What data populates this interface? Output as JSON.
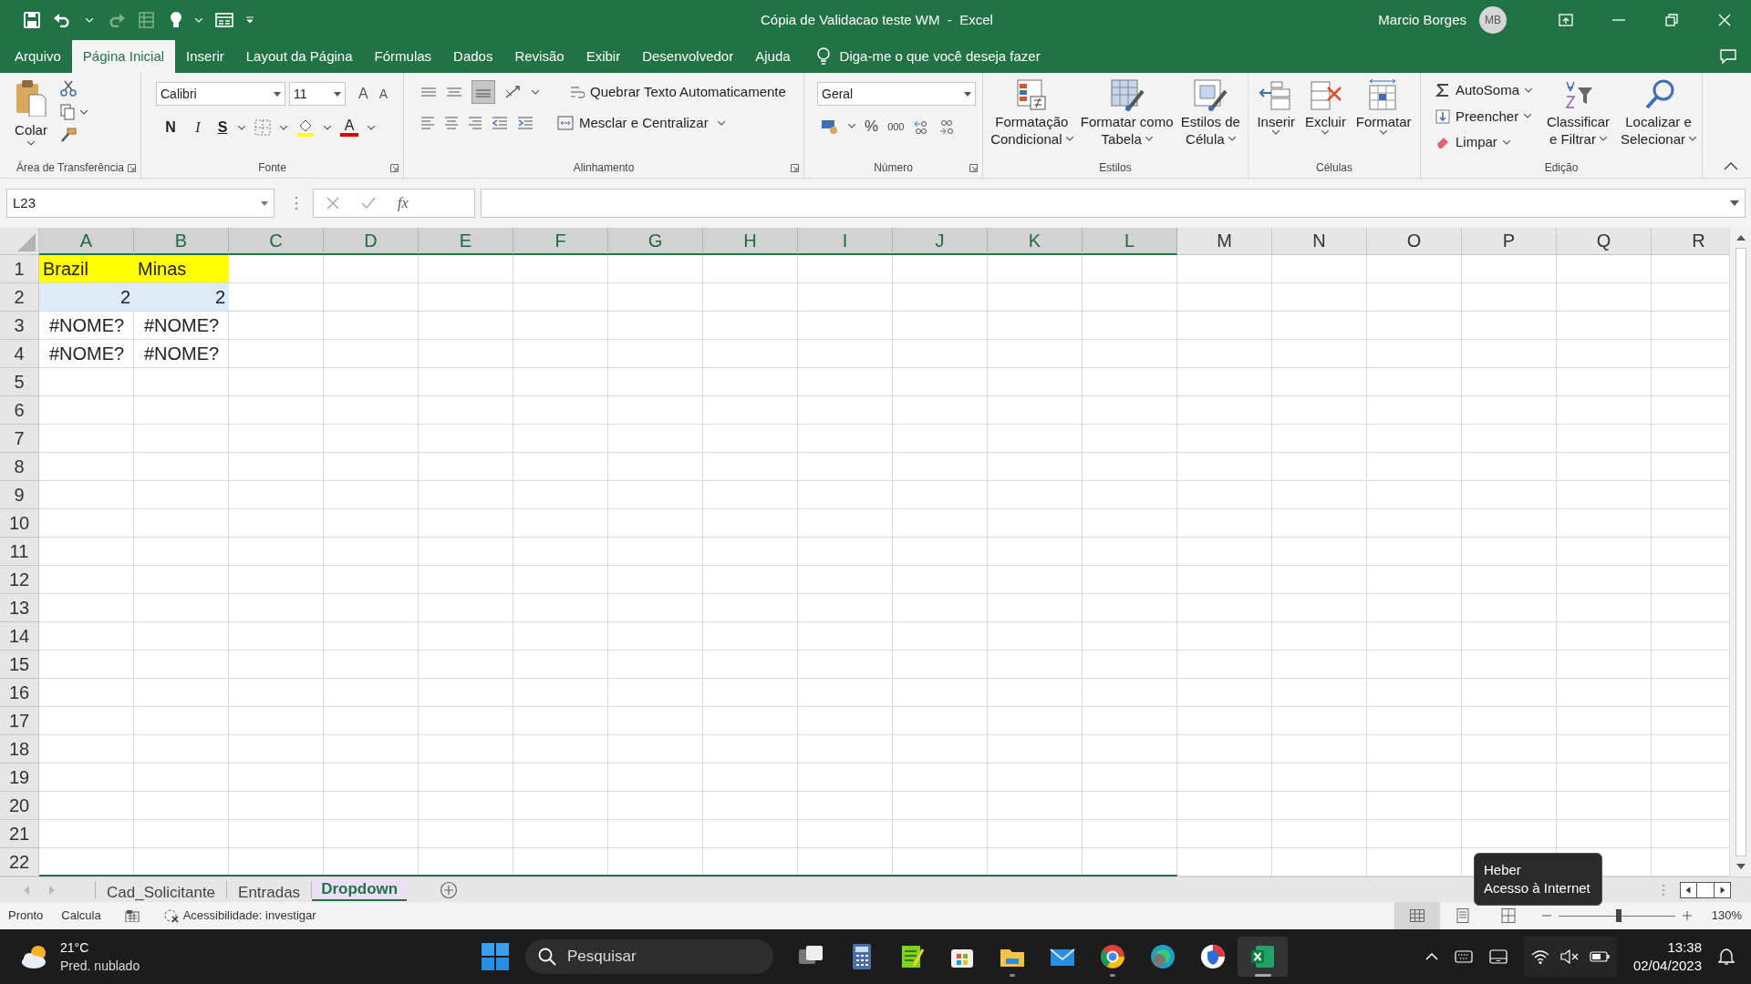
{
  "window": {
    "title": "Cópia de Validacao teste WM  -  Excel",
    "user": "Marcio Borges",
    "user_initials": "MB"
  },
  "ribbon_tabs": [
    {
      "label": "Arquivo",
      "selected": false
    },
    {
      "label": "Página Inicial",
      "selected": true
    },
    {
      "label": "Inserir",
      "selected": false
    },
    {
      "label": "Layout da Página",
      "selected": false
    },
    {
      "label": "Fórmulas",
      "selected": false
    },
    {
      "label": "Dados",
      "selected": false
    },
    {
      "label": "Revisão",
      "selected": false
    },
    {
      "label": "Exibir",
      "selected": false
    },
    {
      "label": "Desenvolvedor",
      "selected": false
    },
    {
      "label": "Ajuda",
      "selected": false
    }
  ],
  "tell_me": {
    "placeholder": "Diga-me o que você deseja fazer"
  },
  "ribbon": {
    "clipboard": {
      "paste": "Colar",
      "label": "Área de Transferência"
    },
    "font": {
      "name": "Calibri",
      "size": "11",
      "grow": "A",
      "shrink": "A",
      "bold": "N",
      "italic": "I",
      "underline": "S",
      "font_color": "A",
      "label": "Fonte"
    },
    "alignment": {
      "wrap": "Quebrar Texto Automaticamente",
      "merge": "Mesclar e Centralizar",
      "label": "Alinhamento"
    },
    "number": {
      "format": "Geral",
      "percent": "%",
      "thousands": "000",
      "label": "Número"
    },
    "styles": {
      "buttons": [
        [
          "Formatação",
          "Condicional"
        ],
        [
          "Formatar como",
          "Tabela"
        ],
        [
          "Estilos de",
          "Célula"
        ]
      ],
      "label": "Estilos"
    },
    "cells": {
      "buttons": [
        "Inserir",
        "Excluir",
        "Formatar"
      ],
      "label": "Células"
    },
    "editing": {
      "autosum": "AutoSoma",
      "fill": "Preencher",
      "clear": "Limpar",
      "sort": [
        "Classificar",
        "e Filtrar"
      ],
      "find": [
        "Localizar e",
        "Selecionar"
      ],
      "label": "Edição"
    }
  },
  "formula_bar": {
    "name_box": "L23",
    "function_label": "fx"
  },
  "sheet": {
    "columns": [
      {
        "label": "A",
        "selected": true
      },
      {
        "label": "B",
        "selected": true
      },
      {
        "label": "C",
        "selected": true
      },
      {
        "label": "D",
        "selected": true
      },
      {
        "label": "E",
        "selected": true
      },
      {
        "label": "F",
        "selected": true
      },
      {
        "label": "G",
        "selected": true
      },
      {
        "label": "H",
        "selected": true
      },
      {
        "label": "I",
        "selected": true
      },
      {
        "label": "J",
        "selected": true
      },
      {
        "label": "K",
        "selected": true
      },
      {
        "label": "L",
        "selected": true
      },
      {
        "label": "M",
        "selected": false
      },
      {
        "label": "N",
        "selected": false
      },
      {
        "label": "O",
        "selected": false
      },
      {
        "label": "P",
        "selected": false
      },
      {
        "label": "Q",
        "selected": false
      },
      {
        "label": "R",
        "selected": false
      }
    ],
    "rows": [
      {
        "label": "1",
        "cells": [
          {
            "text": "Brazil",
            "kind": "text",
            "color": "#ffff00"
          },
          {
            "text": "Minas",
            "kind": "text",
            "color": "#ffff00"
          }
        ]
      },
      {
        "label": "2",
        "cells": [
          {
            "text": "2",
            "kind": "number",
            "color": "#ddebf7"
          },
          {
            "text": "2",
            "kind": "number",
            "color": "#ddebf7"
          }
        ]
      },
      {
        "label": "3",
        "cells": [
          {
            "text": "#NOME?",
            "kind": "error"
          },
          {
            "text": "#NOME?",
            "kind": "error"
          }
        ]
      },
      {
        "label": "4",
        "cells": [
          {
            "text": "#NOME?",
            "kind": "error"
          },
          {
            "text": "#NOME?",
            "kind": "error"
          }
        ]
      },
      {
        "label": "5"
      },
      {
        "label": "6"
      },
      {
        "label": "7"
      },
      {
        "label": "8"
      },
      {
        "label": "9"
      },
      {
        "label": "10"
      },
      {
        "label": "11"
      },
      {
        "label": "12"
      },
      {
        "label": "13"
      },
      {
        "label": "14"
      },
      {
        "label": "15"
      },
      {
        "label": "16"
      },
      {
        "label": "17"
      },
      {
        "label": "18"
      },
      {
        "label": "19"
      },
      {
        "label": "20"
      },
      {
        "label": "21"
      },
      {
        "label": "22"
      }
    ]
  },
  "sheet_tabs": [
    {
      "label": "Cad_Solicitante",
      "selected": false
    },
    {
      "label": "Entradas",
      "selected": false
    },
    {
      "label": "Dropdown",
      "selected": true
    }
  ],
  "status_bar": {
    "mode": "Pronto",
    "calc": "Calcula",
    "accessibility": "Acessibilidade: investigar",
    "zoom": "130%",
    "level": 0.52
  },
  "tooltip": {
    "title": "Heber",
    "text": "Acesso à Internet"
  },
  "taskbar": {
    "weather": {
      "temp": "21°C",
      "text": "Pred. nublado"
    },
    "search": {
      "placeholder": "Pesquisar"
    },
    "time": "13:38",
    "date": "02/04/2023"
  }
}
